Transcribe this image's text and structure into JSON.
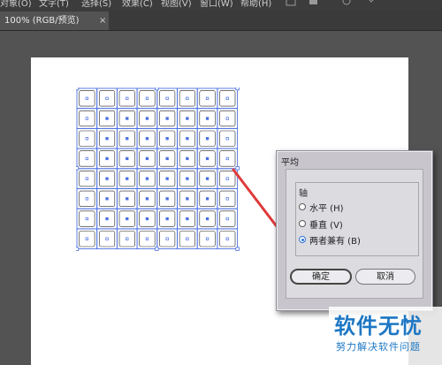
{
  "menubar": {
    "items": [
      "对象(O)",
      "文字(T)",
      "选择(S)",
      "效果(C)",
      "视图(V)",
      "窗口(W)",
      "帮助(H)"
    ]
  },
  "document_tab": {
    "label": "100% (RGB/预览)",
    "close_glyph": "×"
  },
  "canvas": {
    "grid_rows": 8,
    "grid_cols": 8,
    "selection_color": "#4a6fe0"
  },
  "dialog": {
    "title": "平均",
    "group_label": "轴",
    "options": [
      {
        "label": "水平 (H)",
        "checked": false
      },
      {
        "label": "垂直 (V)",
        "checked": false
      },
      {
        "label": "两者兼有 (B)",
        "checked": true
      }
    ],
    "ok_label": "确定",
    "cancel_label": "取消"
  },
  "annotation_color": "#e03a3a",
  "watermark": {
    "title": "软件无忧",
    "subtitle": "努力解决软件问题"
  }
}
